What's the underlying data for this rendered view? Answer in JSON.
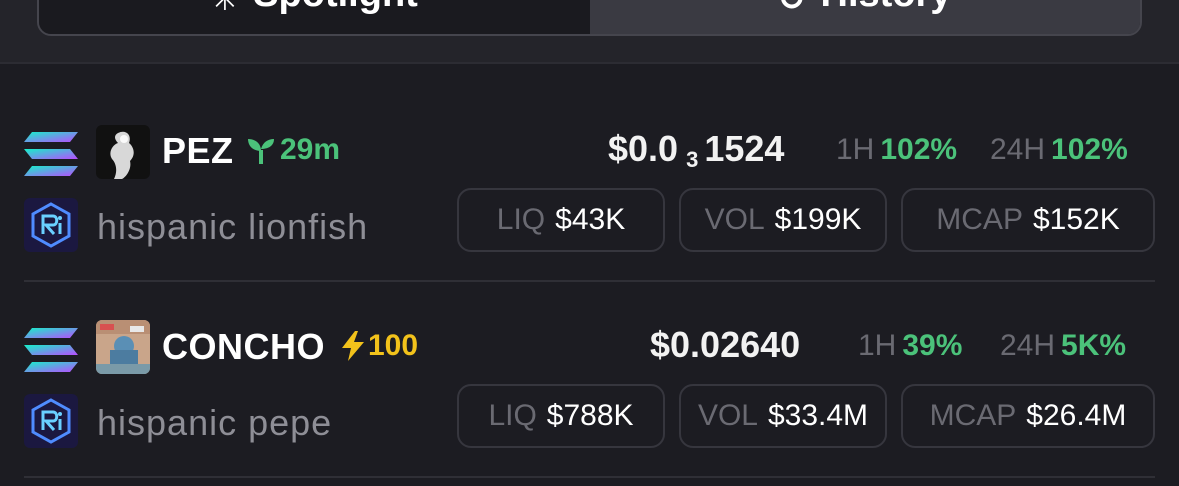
{
  "tabs": [
    {
      "label": "Spotlight",
      "icon": "sparkle-icon",
      "active": true
    },
    {
      "label": "History",
      "icon": "history-icon",
      "active": false
    }
  ],
  "tokens": [
    {
      "symbol": "PEZ",
      "badge": {
        "icon": "sprout-icon",
        "text": "29m",
        "color": "#4bc27a"
      },
      "name": "hispanic lionfish",
      "price": {
        "prefix": "$0.0",
        "zeros": "3",
        "digits": "1524"
      },
      "h1_label": "1H",
      "h1_value": "102%",
      "h24_label": "24H",
      "h24_value": "102%",
      "liq_label": "LIQ",
      "liq_value": "$43K",
      "vol_label": "VOL",
      "vol_value": "$199K",
      "mcap_label": "MCAP",
      "mcap_value": "$152K"
    },
    {
      "symbol": "CONCHO",
      "badge": {
        "icon": "lightning-icon",
        "text": "100",
        "color": "#f2c21b"
      },
      "name": "hispanic pepe",
      "price": {
        "prefix": "$0.02640",
        "zeros": "",
        "digits": ""
      },
      "h1_label": "1H",
      "h1_value": "39%",
      "h24_label": "24H",
      "h24_value": "5K%",
      "liq_label": "LIQ",
      "liq_value": "$788K",
      "vol_label": "VOL",
      "vol_value": "$33.4M",
      "mcap_label": "MCAP",
      "mcap_value": "$26.4M"
    }
  ],
  "colors": {
    "positive": "#4bc27a",
    "accent_yellow": "#f2c21b",
    "background": "#1c1c22"
  }
}
